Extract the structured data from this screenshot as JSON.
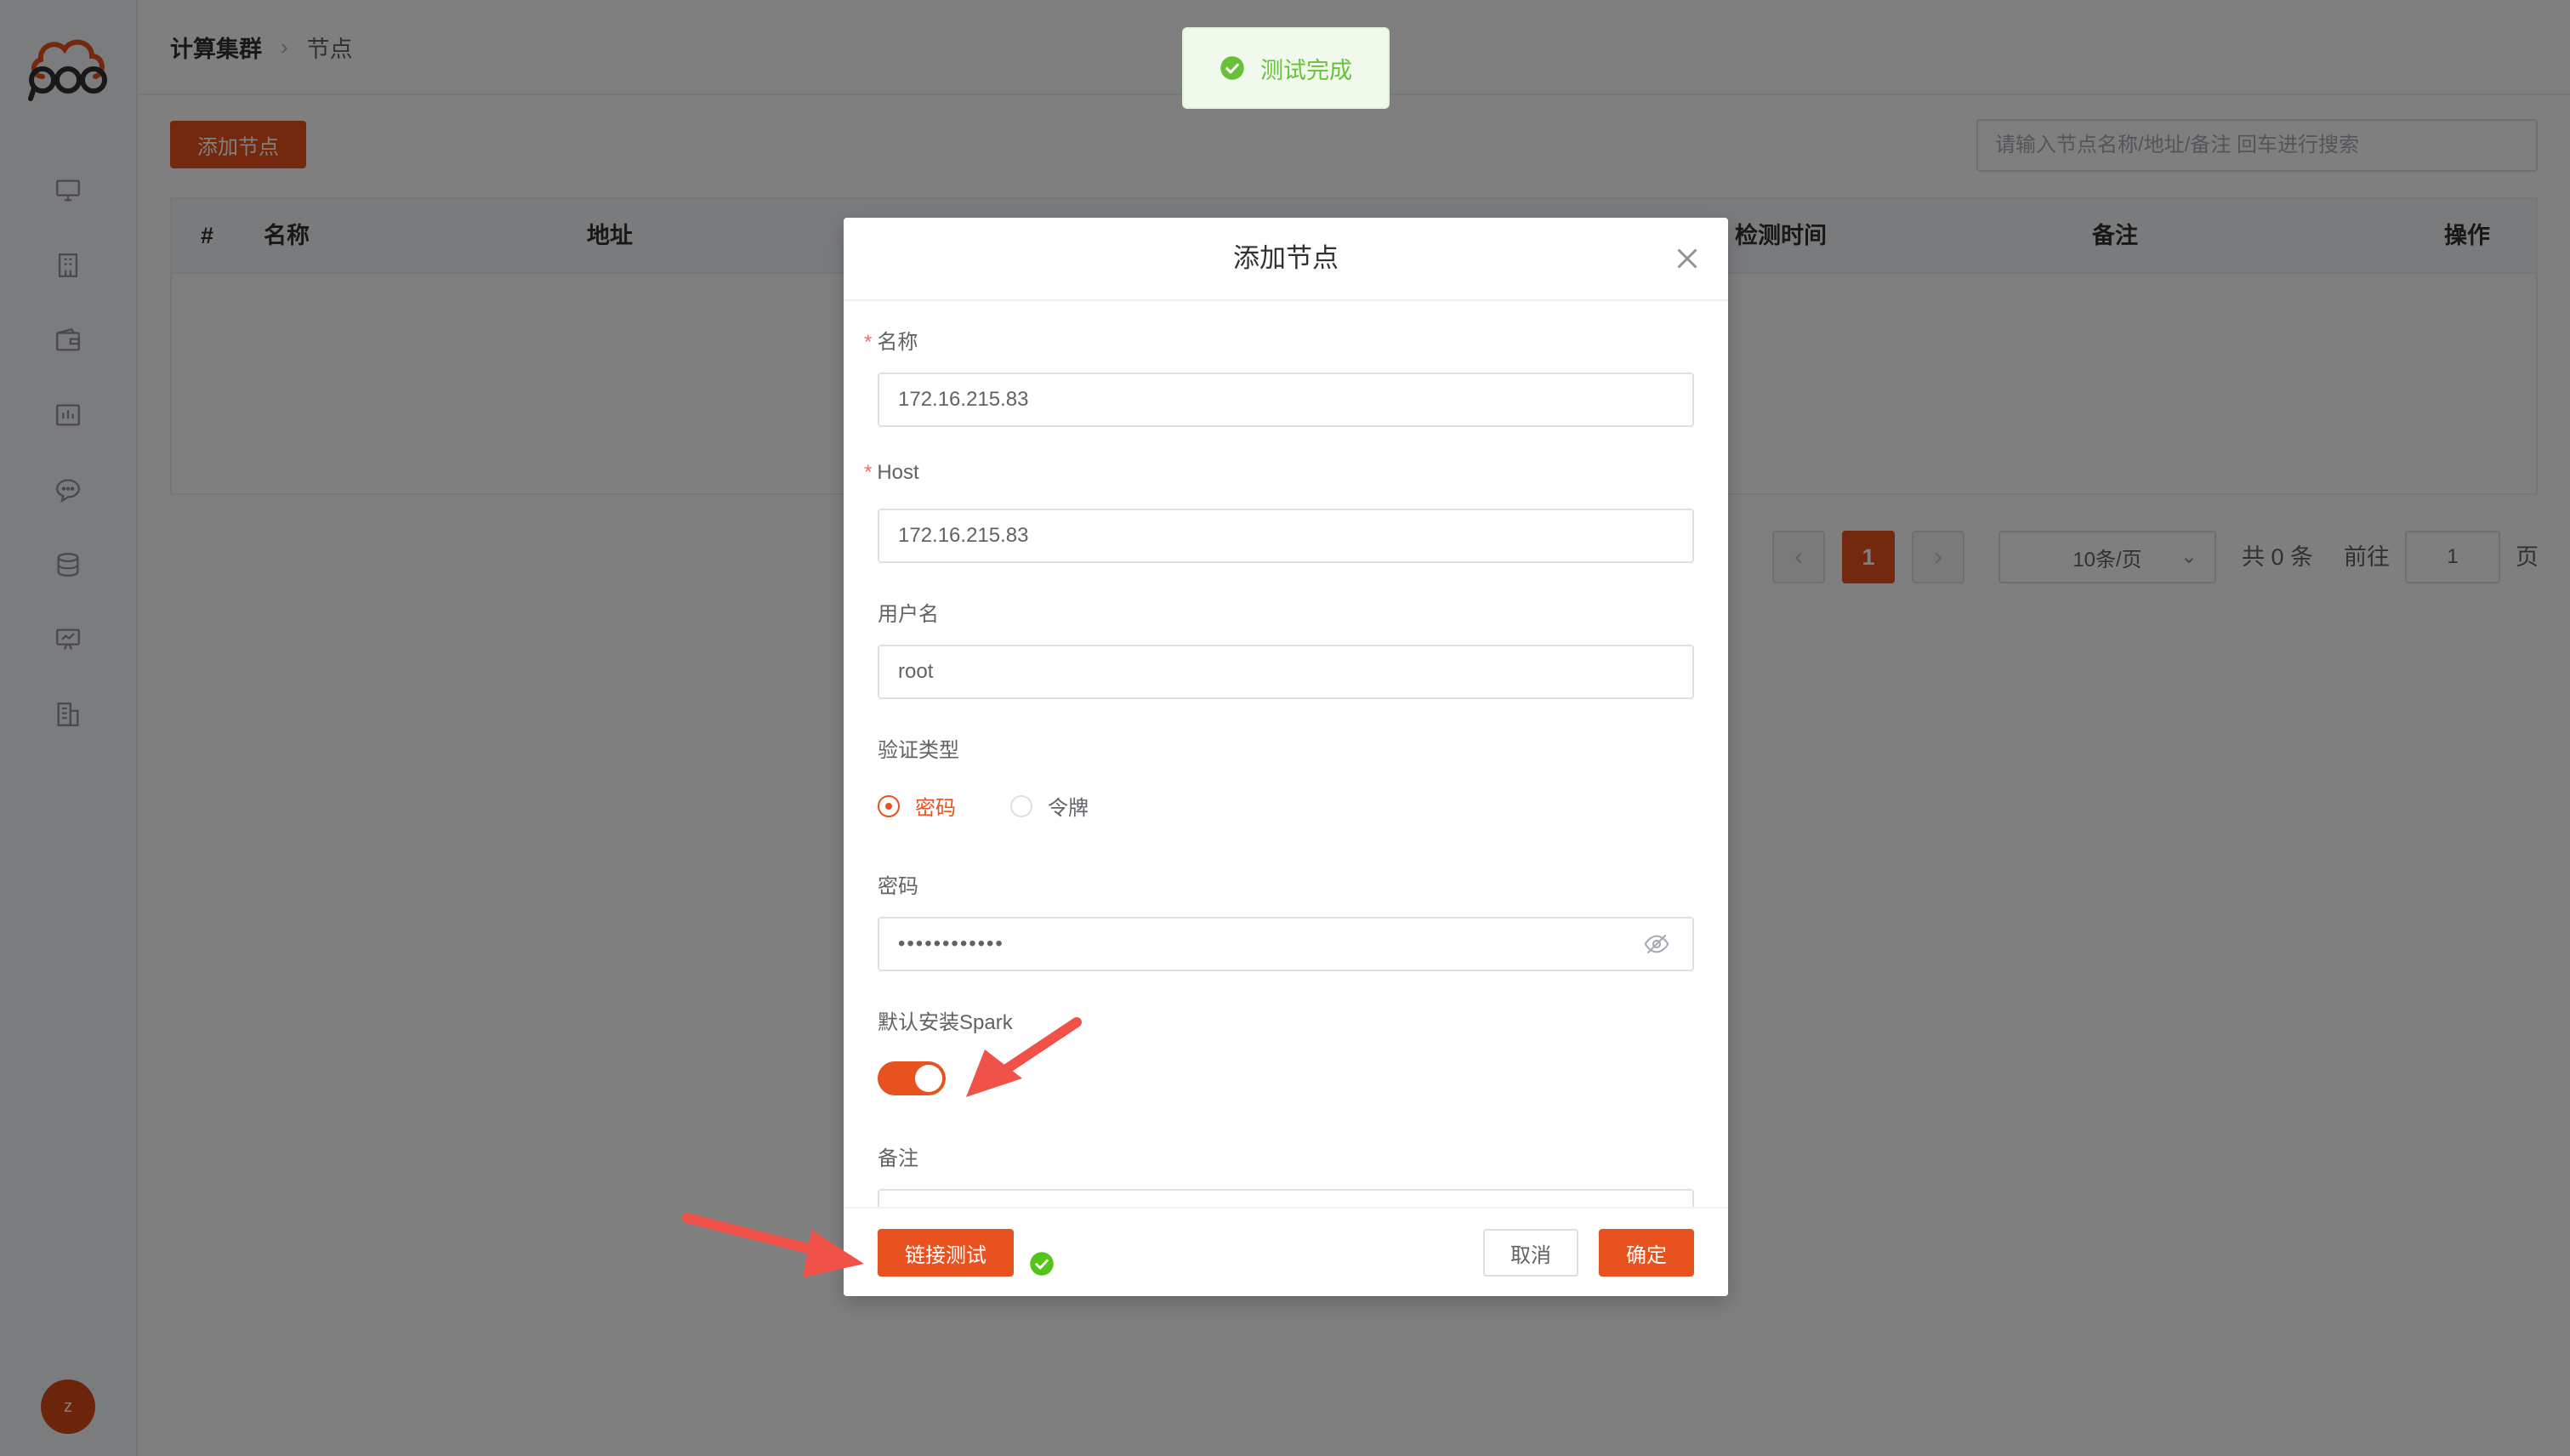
{
  "breadcrumb": {
    "parent": "计算集群",
    "separator": "›",
    "current": "节点"
  },
  "toolbar": {
    "add_label": "添加节点",
    "search_placeholder": "请输入节点名称/地址/备注 回车进行搜索"
  },
  "table": {
    "columns": {
      "index": "#",
      "name": "名称",
      "address": "地址",
      "checked_at": "检测时间",
      "remark": "备注",
      "actions": "操作"
    }
  },
  "pagination": {
    "prev": "‹",
    "current_page": "1",
    "next": "›",
    "page_size": "10条/页",
    "total": "共 0 条",
    "goto": "前往",
    "goto_value": "1",
    "page_suffix": "页"
  },
  "toast": {
    "message": "测试完成"
  },
  "dialog": {
    "title": "添加节点",
    "name_label": "名称",
    "name_value": "172.16.215.83",
    "host_label": "Host",
    "host_value": "172.16.215.83",
    "username_label": "用户名",
    "username_value": "root",
    "auth_label": "验证类型",
    "auth_password": "密码",
    "auth_token": "令牌",
    "password_label": "密码",
    "password_value": "••••••••••••",
    "spark_label": "默认安装Spark",
    "spark_enabled": true,
    "remark_label": "备注",
    "test_button": "链接测试",
    "cancel_button": "取消",
    "confirm_button": "确定"
  },
  "user": {
    "avatar_letter": "z"
  },
  "colors": {
    "accent": "#e8521e",
    "success": "#67c23a",
    "annotation_arrow": "#f0524a"
  }
}
